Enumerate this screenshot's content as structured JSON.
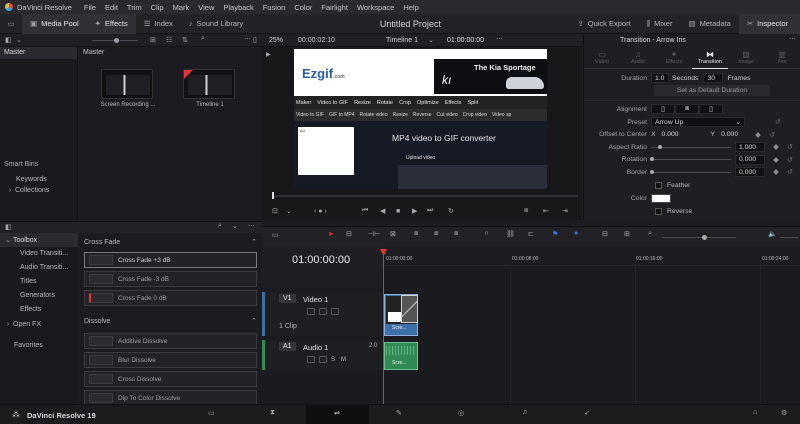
{
  "menubar": {
    "app_name": "DaVinci Resolve",
    "items": [
      "File",
      "Edit",
      "Trim",
      "Clip",
      "Mark",
      "View",
      "Playback",
      "Fusion",
      "Color",
      "Fairlight",
      "Workspace",
      "Help"
    ]
  },
  "toolbar": {
    "media_pool": "Media Pool",
    "effects": "Effects",
    "index": "Index",
    "sound_library": "Sound Library",
    "project_title": "Untitled Project",
    "quick_export": "Quick Export",
    "mixer": "Mixer",
    "metadata": "Metadata",
    "inspector": "Inspector"
  },
  "subbar": {
    "zoom": "25%",
    "source_tc": "00:00:02:10",
    "timeline_name": "Timeline 1",
    "record_tc": "01:00:00:00"
  },
  "bins": {
    "master": "Master",
    "smart_bins": "Smart Bins",
    "items": [
      "Keywords",
      "Collections"
    ]
  },
  "pool": {
    "title": "Master",
    "clips": [
      {
        "label": "Screen Recording ..."
      },
      {
        "label": "Timeline 1"
      }
    ]
  },
  "viewer": {
    "site_logo": "Ezgif",
    "site_logo_suffix": ".com",
    "ad_text": "The Kia Sportage",
    "nav": [
      "Maker",
      "Video to GIF",
      "Resize",
      "Rotate",
      "Crop",
      "Optimize",
      "Effects",
      "Split"
    ],
    "subnav": [
      "Video to GIF",
      "GIF to MP4",
      "Rotate video",
      "Resize",
      "Reverse",
      "Cut video",
      "Crop video",
      "Video sp"
    ],
    "page_heading": "MP4 video to GIF converter",
    "upload_label": "Upload video",
    "ad_badge": "Ad"
  },
  "inspector": {
    "title": "Transition - Arrow Iris",
    "tabs": [
      "Video",
      "Audio",
      "Effects",
      "Transition",
      "Image",
      "File"
    ],
    "active_tab": "Transition",
    "duration_label": "Duration",
    "duration_seconds": "1.0",
    "seconds_label": "Seconds",
    "duration_frames": "30",
    "frames_label": "Frames",
    "default_btn": "Set as Default Duration",
    "alignment_label": "Alignment",
    "preset_label": "Preset",
    "preset_value": "Arrow Up",
    "offset_label": "Offset to Center",
    "offset_x_label": "X",
    "offset_x": "0.000",
    "offset_y_label": "Y",
    "offset_y": "0.000",
    "aspect_label": "Aspect Ratio",
    "aspect_value": "1.000",
    "rotation_label": "Rotation",
    "rotation_value": "0.000",
    "border_label": "Border",
    "border_value": "0.000",
    "feather_label": "Feather",
    "color_label": "Color",
    "reverse_label": "Reverse"
  },
  "effects": {
    "tree": [
      {
        "label": "Toolbox",
        "expanded": true,
        "active": true
      },
      {
        "label": "Video Transiti...",
        "child": true
      },
      {
        "label": "Audio Transiti...",
        "child": true
      },
      {
        "label": "Titles",
        "child": true
      },
      {
        "label": "Generators",
        "child": true
      },
      {
        "label": "Effects",
        "child": true
      },
      {
        "label": "Open FX",
        "expanded": false
      },
      {
        "label": "Favorites"
      }
    ],
    "group_cross_fade": "Cross Fade",
    "cross_fade_items": [
      "Cross Fade +3 dB",
      "Cross Fade -3 dB",
      "Cross Fade 0 dB"
    ],
    "group_dissolve": "Dissolve",
    "dissolve_items": [
      "Additive Dissolve",
      "Blur Dissolve",
      "Cross Dissolve",
      "Dip To Color Dissolve"
    ]
  },
  "timeline": {
    "timecode": "01:00:00:00",
    "ruler": [
      "01:00:00:00",
      "01:00:08:00",
      "01:00:16:00",
      "01:00:24:00"
    ],
    "v1_id": "V1",
    "v1_name": "Video 1",
    "v1_clip_count": "1 Clip",
    "a1_id": "A1",
    "a1_name": "Audio 1",
    "a1_level": "2.0",
    "clip_label": "Scre...",
    "audio_solo": "S",
    "audio_mute": "M"
  },
  "pagebar": {
    "brand": "DaVinci Resolve 19"
  },
  "colors": {
    "accent_red": "#e0353a",
    "video_clip": "#3f6fa8",
    "audio_clip": "#2f8a55",
    "inspector_active": "#e6e6ea"
  }
}
